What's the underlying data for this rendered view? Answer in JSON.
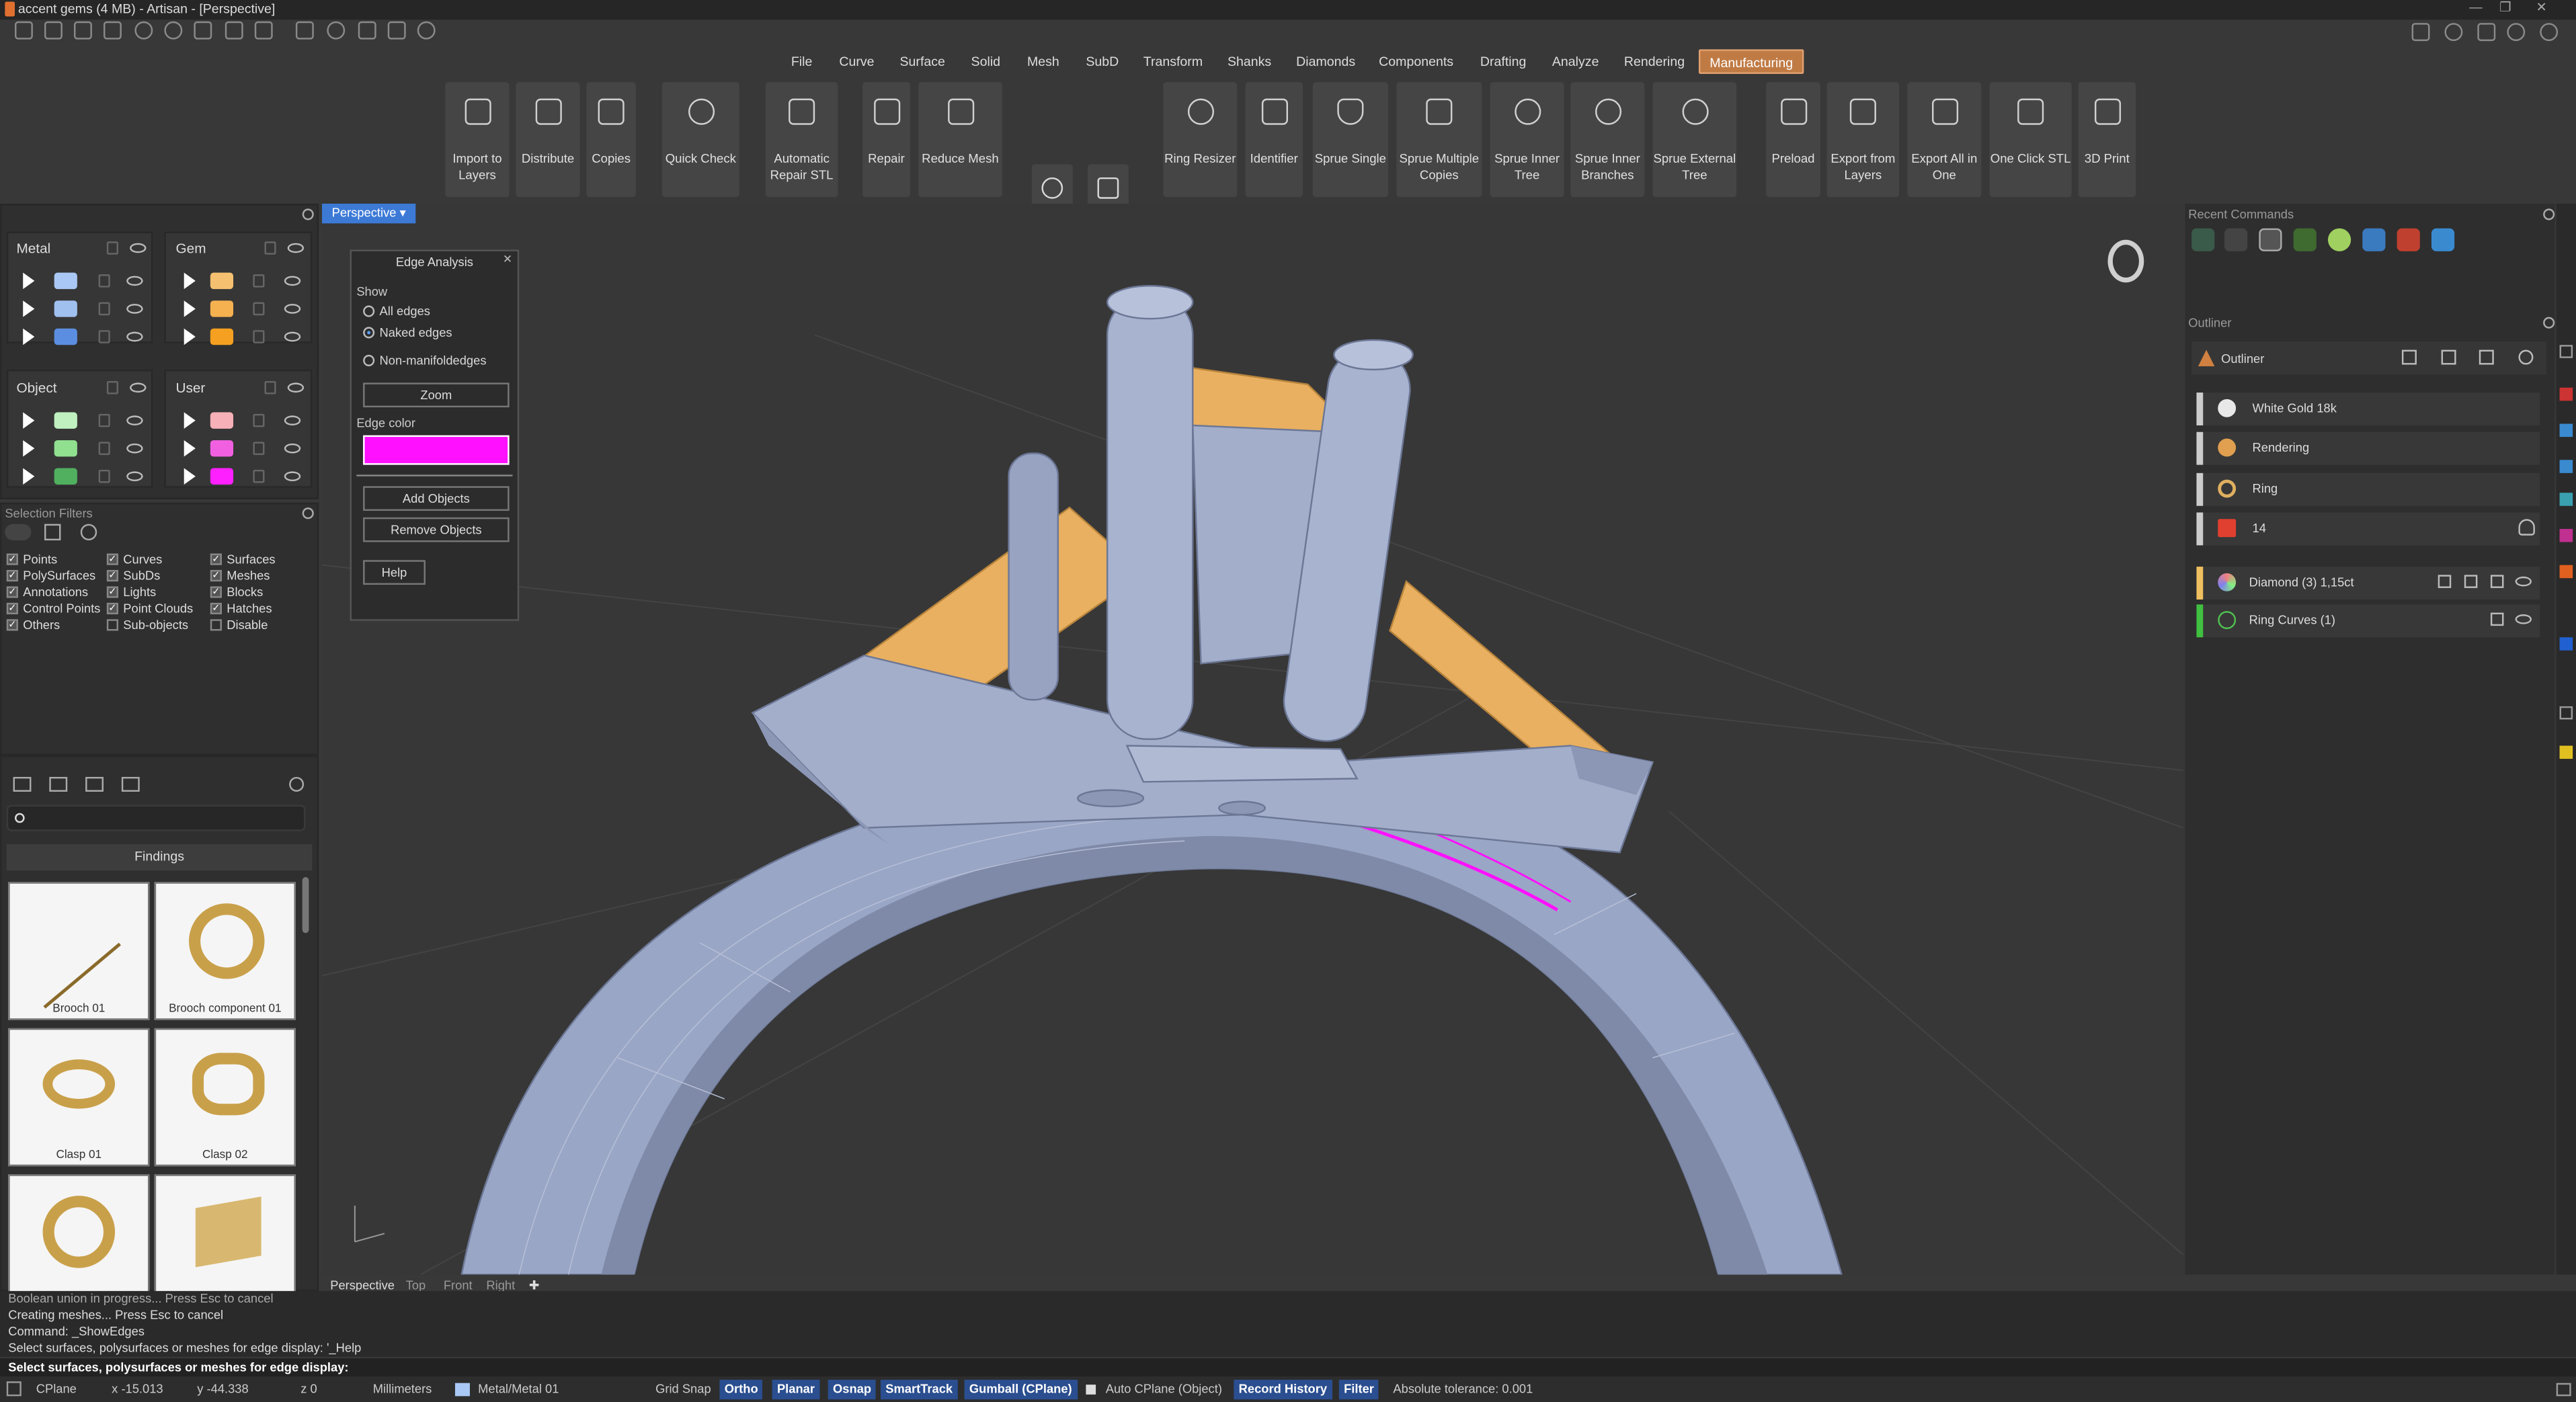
{
  "window": {
    "title": "accent gems (4 MB) - Artisan - [Perspective]"
  },
  "menus": [
    "File",
    "Curve",
    "Surface",
    "Solid",
    "Mesh",
    "SubD",
    "Transform",
    "Shanks",
    "Diamonds",
    "Components",
    "Drafting",
    "Analyze",
    "Rendering",
    "Manufacturing"
  ],
  "active_menu": "Manufacturing",
  "ribbon": [
    {
      "label": "Import to Layers",
      "icon": "import-icon"
    },
    {
      "label": "Distribute",
      "icon": "distribute-icon"
    },
    {
      "label": "Copies",
      "icon": "copies-icon"
    },
    {
      "label": "Quick Check",
      "icon": "check-icon"
    },
    {
      "label": "Automatic Repair STL",
      "icon": "wand-icon"
    },
    {
      "label": "Repair",
      "icon": "wrench-icon"
    },
    {
      "label": "Reduce Mesh",
      "icon": "mesh-icon"
    },
    {
      "label": "Ring Resizer",
      "icon": "ring-resize-icon"
    },
    {
      "label": "Identifier",
      "icon": "ref-icon"
    },
    {
      "label": "Sprue Single",
      "icon": "sprue-icon"
    },
    {
      "label": "Sprue Multiple Copies",
      "icon": "sprue-tree-icon"
    },
    {
      "label": "Sprue Inner Tree",
      "icon": "sprue-inner-icon"
    },
    {
      "label": "Sprue Inner Branches",
      "icon": "sprue-branches-icon"
    },
    {
      "label": "Sprue External Tree",
      "icon": "sprue-external-icon"
    },
    {
      "label": "Preload",
      "icon": "preload-icon"
    },
    {
      "label": "Export from Layers",
      "icon": "export-layers-icon"
    },
    {
      "label": "Export All in One",
      "icon": "export-all-icon"
    },
    {
      "label": "One Click STL",
      "icon": "stl-icon"
    },
    {
      "label": "3D Print",
      "icon": "print-icon"
    }
  ],
  "layers": {
    "metal": {
      "title": "Metal",
      "colors": [
        "#aac8f5",
        "#a0c0f0",
        "#5b8ee0"
      ]
    },
    "gem": {
      "title": "Gem",
      "colors": [
        "#f5c070",
        "#f5b050",
        "#f5a020"
      ]
    },
    "object": {
      "title": "Object",
      "colors": [
        "#c0f0c0",
        "#90e090",
        "#50b060"
      ]
    },
    "user": {
      "title": "User",
      "colors": [
        "#f5b0b8",
        "#f060e0",
        "#ff20ff"
      ]
    }
  },
  "selection_filters": {
    "title": "Selection Filters",
    "items": [
      {
        "label": "Points",
        "checked": true
      },
      {
        "label": "Curves",
        "checked": true
      },
      {
        "label": "Surfaces",
        "checked": true
      },
      {
        "label": "PolySurfaces",
        "checked": true
      },
      {
        "label": "SubDs",
        "checked": true
      },
      {
        "label": "Meshes",
        "checked": true
      },
      {
        "label": "Annotations",
        "checked": true
      },
      {
        "label": "Lights",
        "checked": true
      },
      {
        "label": "Blocks",
        "checked": true
      },
      {
        "label": "Control Points",
        "checked": true
      },
      {
        "label": "Point Clouds",
        "checked": true
      },
      {
        "label": "Hatches",
        "checked": true
      },
      {
        "label": "Others",
        "checked": true
      },
      {
        "label": "Sub-objects",
        "checked": false
      },
      {
        "label": "Disable",
        "checked": false
      }
    ]
  },
  "library": {
    "category": "Findings",
    "items": [
      "Brooch 01",
      "Brooch component 01",
      "Clasp 01",
      "Clasp 02",
      "",
      ""
    ]
  },
  "viewport": {
    "name": "Perspective",
    "tabs": [
      "Perspective",
      "Top",
      "Front",
      "Right"
    ]
  },
  "edge_dialog": {
    "title": "Edge Analysis",
    "show_label": "Show",
    "options": [
      "All edges",
      "Naked edges",
      "Non-manifoldedges"
    ],
    "selected": "Naked edges",
    "zoom": "Zoom",
    "edge_color_label": "Edge color",
    "edge_color": "#ff10ff",
    "add": "Add Objects",
    "remove": "Remove Objects",
    "help": "Help"
  },
  "right_panel": {
    "recent_title": "Recent Commands",
    "outliner_title": "Outliner",
    "outliner_header": "Outliner",
    "rows": [
      {
        "name": "White Gold 18k",
        "bar": "#d0d0d0",
        "icon": "#e8e8e8"
      },
      {
        "name": "Rendering",
        "bar": "#d0d0d0",
        "icon": "#e0a050"
      },
      {
        "name": "Ring",
        "bar": "#d0d0d0",
        "icon": "#e0b060"
      },
      {
        "name": "14",
        "bar": "#d0d0d0",
        "icon": "#e04030"
      },
      {
        "name": "Diamond (3) 1,15ct",
        "bar": "#f0c060",
        "icon": "#c0a0f0"
      },
      {
        "name": "Ring Curves (1)",
        "bar": "#40c040",
        "icon": "#50c050"
      }
    ]
  },
  "command_history": [
    "Boolean union in progress... Press Esc to cancel",
    "Creating meshes... Press Esc to cancel",
    "Command: _ShowEdges",
    "Select surfaces, polysurfaces or meshes for edge display: '_Help"
  ],
  "prompt": "Select surfaces, polysurfaces or meshes for edge display:",
  "status": {
    "cplane": "CPlane",
    "x": "x -15.013",
    "y": "y -44.338",
    "z": "z 0",
    "units": "Millimeters",
    "layer": "Metal/Metal 01",
    "grid_snap": "Grid Snap",
    "ortho": "Ortho",
    "planar": "Planar",
    "osnap": "Osnap",
    "smarttrack": "SmartTrack",
    "gumball": "Gumball (CPlane)",
    "auto_cplane": "Auto CPlane (Object)",
    "record_history": "Record History",
    "filter": "Filter",
    "tolerance": "Absolute tolerance: 0.001"
  }
}
